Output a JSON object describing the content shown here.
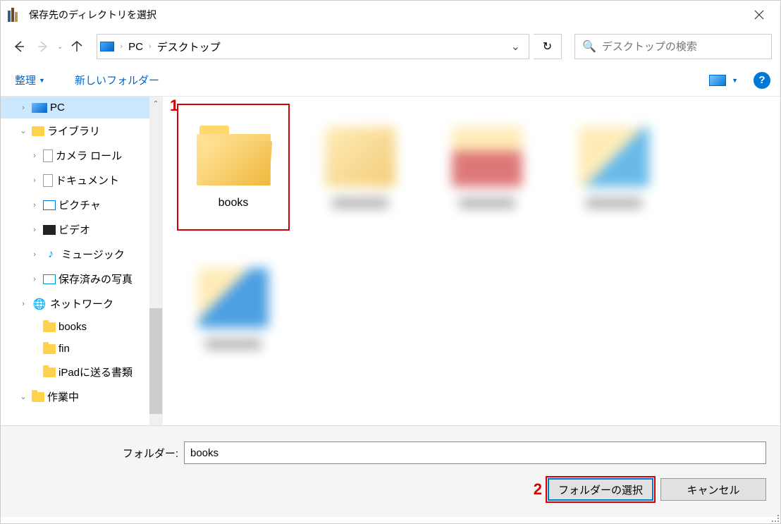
{
  "title": "保存先のディレクトリを選択",
  "breadcrumb": {
    "root": "PC",
    "current": "デスクトップ"
  },
  "search": {
    "placeholder": "デスクトップの検索"
  },
  "toolbar": {
    "organize": "整理",
    "new_folder": "新しいフォルダー"
  },
  "sidebar": {
    "items": [
      {
        "label": "PC",
        "icon": "pc",
        "chev": "right",
        "indent": 1,
        "selected": true
      },
      {
        "label": "ライブラリ",
        "icon": "lib",
        "chev": "down",
        "indent": 1
      },
      {
        "label": "カメラ ロール",
        "icon": "doc",
        "chev": "right",
        "indent": 2
      },
      {
        "label": "ドキュメント",
        "icon": "doc",
        "chev": "right",
        "indent": 2
      },
      {
        "label": "ピクチャ",
        "icon": "pic",
        "chev": "right",
        "indent": 2
      },
      {
        "label": "ビデオ",
        "icon": "vid",
        "chev": "right",
        "indent": 2
      },
      {
        "label": "ミュージック",
        "icon": "mus",
        "chev": "right",
        "indent": 2
      },
      {
        "label": "保存済みの写真",
        "icon": "saved",
        "chev": "right",
        "indent": 2
      },
      {
        "label": "ネットワーク",
        "icon": "net",
        "chev": "right",
        "indent": 1
      },
      {
        "label": "books",
        "icon": "folder",
        "chev": "none",
        "indent": 2
      },
      {
        "label": "fin",
        "icon": "folder",
        "chev": "none",
        "indent": 2
      },
      {
        "label": "iPadに送る書類",
        "icon": "folder",
        "chev": "none",
        "indent": 2
      },
      {
        "label": "作業中",
        "icon": "folder",
        "chev": "down",
        "indent": 1
      }
    ]
  },
  "content": {
    "selected_folder": "books"
  },
  "annotations": {
    "one": "1",
    "two": "2"
  },
  "bottom": {
    "folder_label": "フォルダー:",
    "folder_value": "books",
    "select_button": "フォルダーの選択",
    "cancel_button": "キャンセル"
  }
}
